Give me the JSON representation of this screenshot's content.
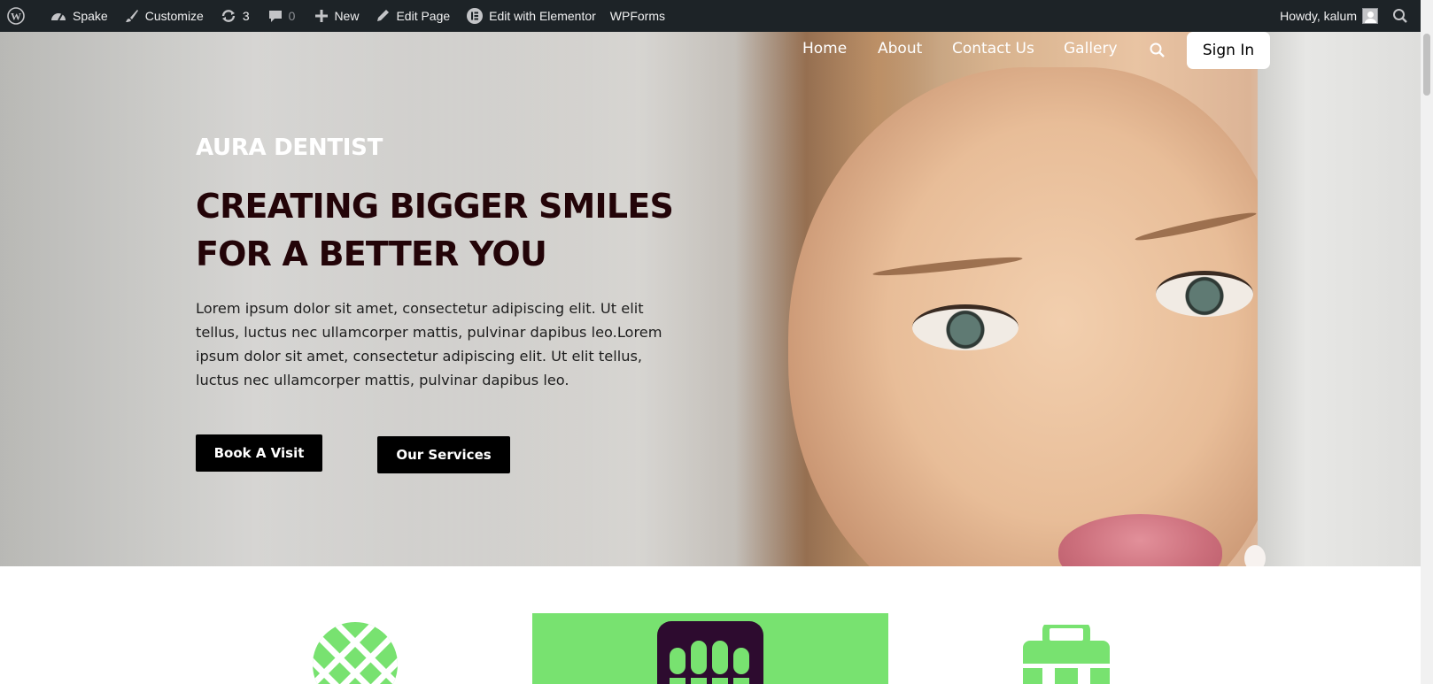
{
  "adminbar": {
    "site_name": "Spake",
    "customize": "Customize",
    "updates_count": "3",
    "comments_count": "0",
    "new": "New",
    "edit_page": "Edit Page",
    "edit_with_elementor": "Edit with Elementor",
    "wpforms": "WPForms",
    "howdy": "Howdy, kalum"
  },
  "nav": {
    "items": [
      {
        "label": "Home"
      },
      {
        "label": "About"
      },
      {
        "label": "Contact Us"
      },
      {
        "label": "Gallery"
      }
    ],
    "signin": "Sign In"
  },
  "hero": {
    "brand": "AURA DENTIST",
    "headline_line1": "CREATING BIGGER SMILES",
    "headline_line2": "FOR A BETTER YOU",
    "lead": "Lorem ipsum dolor sit amet, consectetur adipiscing elit. Ut elit tellus, luctus nec ullamcorper mattis, pulvinar dapibus leo.Lorem ipsum dolor sit amet, consectetur adipiscing elit. Ut elit tellus, luctus nec ullamcorper mattis, pulvinar dapibus leo.",
    "book_button": "Book A Visit",
    "services_button": "Our Services"
  },
  "colors": {
    "adminbar_bg": "#1d2327",
    "headline": "#230408",
    "accent_green": "#78e270",
    "icon_purple": "#2d0b2f",
    "button_bg": "#000000"
  },
  "features": {
    "icons": [
      "mesh-circle-icon",
      "teeth-grid-icon",
      "medical-case-icon"
    ]
  }
}
